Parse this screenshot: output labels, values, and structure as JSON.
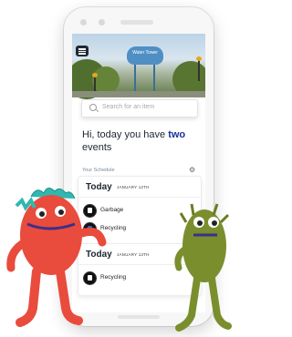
{
  "hero": {
    "tower_text": "Water Tower",
    "menu_icon": "hamburger-menu-icon"
  },
  "search": {
    "placeholder": "Search for an item",
    "icon": "search-icon"
  },
  "greeting": {
    "prefix": "Hi, today you have",
    "count_word": "two",
    "suffix": "events"
  },
  "schedule": {
    "label": "Your Schedule",
    "settings_icon": "gear-icon",
    "days": [
      {
        "day": "Today",
        "date": "JANUARY 12TH",
        "items": [
          {
            "label": "Garbage",
            "icon": "garbage-bin-icon"
          },
          {
            "label": "Recycling",
            "icon": "recycling-bin-icon"
          }
        ]
      },
      {
        "day": "Today",
        "date": "JANUARY 13TH",
        "items": [
          {
            "label": "Recycling",
            "icon": "recycling-bin-icon"
          }
        ]
      }
    ]
  },
  "colors": {
    "accent": "#1a2fa0",
    "red_monster": "#e94b3c",
    "green_monster": "#7a8e2e"
  }
}
